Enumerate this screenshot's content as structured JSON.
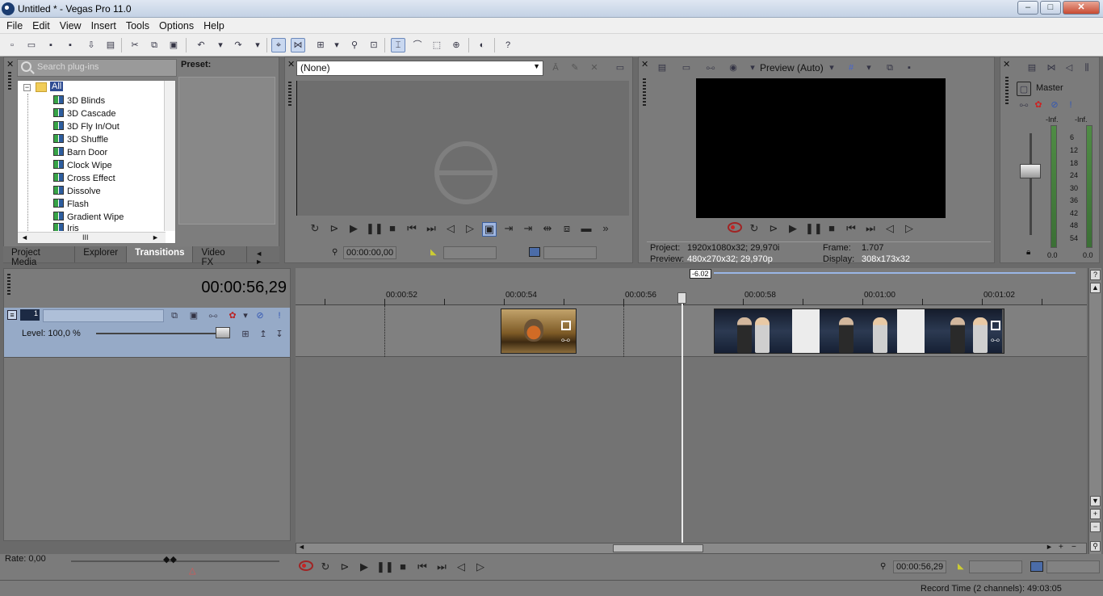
{
  "window": {
    "title": "Untitled * - Vegas Pro 11.0",
    "minimize": "–",
    "maximize": "□",
    "close": "✕"
  },
  "menu": [
    "File",
    "Edit",
    "View",
    "Insert",
    "Tools",
    "Options",
    "Help"
  ],
  "plugins": {
    "search_placeholder": "Search plug-ins",
    "root": "All",
    "items": [
      "3D Blinds",
      "3D Cascade",
      "3D Fly In/Out",
      "3D Shuffle",
      "Barn Door",
      "Clock Wipe",
      "Cross Effect",
      "Dissolve",
      "Flash",
      "Gradient Wipe",
      "Iris"
    ],
    "preset_label": "Preset:",
    "hscroll_glyph": "III"
  },
  "tabs": [
    "Project Media",
    "Explorer",
    "Transitions",
    "Video FX"
  ],
  "tab_nav": "◄ ►",
  "trimmer": {
    "dropdown_value": "(None)",
    "timecode": "00:00:00,00"
  },
  "preview": {
    "mode": "Preview (Auto)",
    "project_label": "Project:",
    "project_value": "1920x1080x32; 29,970i",
    "preview_label": "Preview:",
    "preview_value": "480x270x32; 29,970p",
    "frame_label": "Frame:",
    "frame_value": "1.707",
    "display_label": "Display:",
    "display_value": "308x173x32"
  },
  "mixer": {
    "title": "Master",
    "peak_left": "-Inf.",
    "peak_right": "-Inf.",
    "scale": [
      "6",
      "12",
      "18",
      "24",
      "30",
      "36",
      "42",
      "48",
      "54"
    ],
    "bottom_left": "0.0",
    "bottom_right": "0.0"
  },
  "timeline": {
    "time": "00:00:56,29",
    "marker_value": "-6.02",
    "ruler_labels": [
      "00:00:52",
      "00:00:54",
      "00:00:56",
      "00:00:58",
      "00:01:00",
      "00:01:02"
    ],
    "track_number": "1",
    "level_label": "Level: 100,0 %",
    "rate_label": "Rate: 0,00",
    "bottom_timecode": "00:00:56,29"
  },
  "status": {
    "record_time": "Record Time (2 channels): 49:03:05"
  }
}
